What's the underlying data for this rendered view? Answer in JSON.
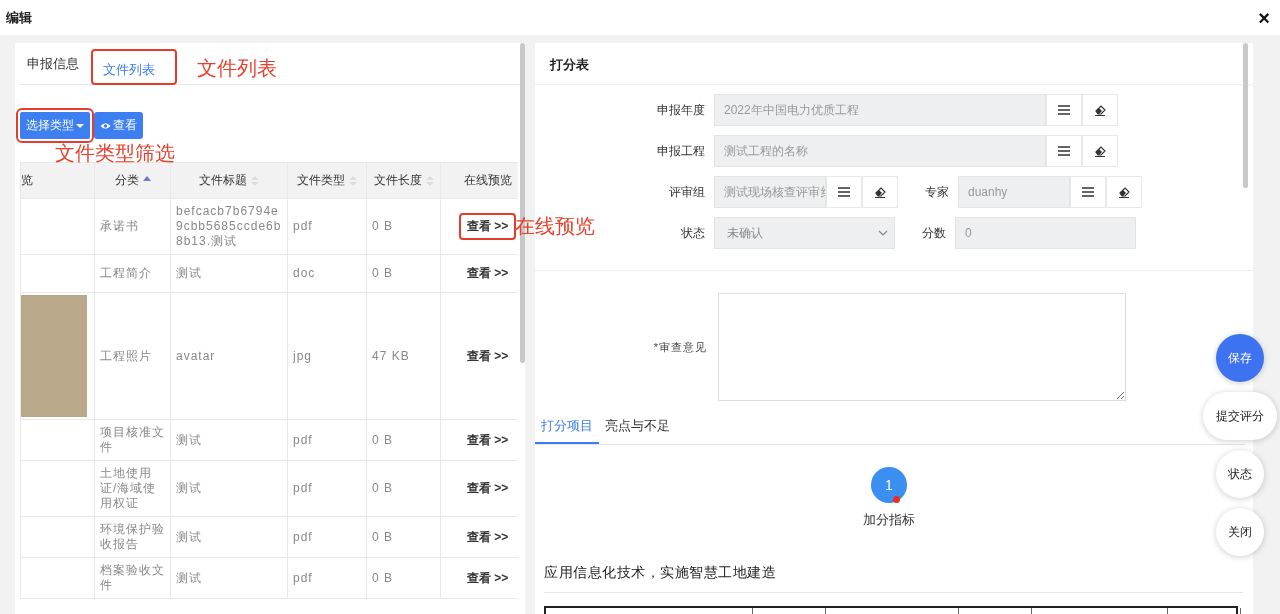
{
  "window": {
    "title": "编辑",
    "close": "×"
  },
  "left_tabs": [
    {
      "label": "申报信息",
      "selected": false,
      "highlighted": false
    },
    {
      "label": "文件列表",
      "selected": true,
      "highlighted": true,
      "annotation": "文件列表"
    }
  ],
  "toolbar": {
    "filter": {
      "label": "选择类型",
      "highlighted": true,
      "annotation": "文件类型筛选"
    },
    "view": {
      "label": "查看"
    }
  },
  "file_table": {
    "columns": [
      {
        "label": "览",
        "sortable": false
      },
      {
        "label": "分类",
        "sortable": true,
        "sorted_ascending": true
      },
      {
        "label": "文件标题",
        "sortable": true,
        "sorted_ascending": false
      },
      {
        "label": "文件类型",
        "sortable": true,
        "sorted_ascending": false
      },
      {
        "label": "文件长度",
        "sortable": true,
        "sorted_ascending": false
      },
      {
        "label": "在线预览",
        "sortable": false
      }
    ],
    "rows": [
      {
        "photo": false,
        "category": "承诺书",
        "title": "befcacb7b6794e9cbb5685ccde6b8b13.测试",
        "type": "pdf",
        "size": "0 B",
        "link": "查看 >>",
        "highlighted": true,
        "annotation": "在线预览"
      },
      {
        "photo": false,
        "category": "工程简介",
        "title": "测试",
        "type": "doc",
        "size": "0 B",
        "link": "查看 >>",
        "highlighted": false
      },
      {
        "photo": true,
        "category": "工程照片",
        "title": "avatar",
        "type": "jpg",
        "size": "47 KB",
        "link": "查看 >>",
        "highlighted": false
      },
      {
        "photo": false,
        "category": "项目核准文件",
        "title": "测试",
        "type": "pdf",
        "size": "0 B",
        "link": "查看 >>",
        "highlighted": false
      },
      {
        "photo": false,
        "category": "土地使用证/海域使用权证",
        "title": "测试",
        "type": "pdf",
        "size": "0 B",
        "link": "查看 >>",
        "highlighted": false
      },
      {
        "photo": false,
        "category": "环境保护验收报告",
        "title": "测试",
        "type": "pdf",
        "size": "0 B",
        "link": "查看 >>",
        "highlighted": false
      },
      {
        "photo": false,
        "category": "档案验收文件",
        "title": "测试",
        "type": "pdf",
        "size": "0 B",
        "link": "查看 >>",
        "highlighted": false
      }
    ]
  },
  "score_sheet": {
    "title": "打分表",
    "form_rows": [
      [
        {
          "label": "申报年度",
          "kind": "picker",
          "value": "2022年中国电力优质工程"
        }
      ],
      [
        {
          "label": "申报工程",
          "kind": "picker",
          "value": "测试工程的名称"
        }
      ],
      [
        {
          "label": "评审组",
          "kind": "picker",
          "value": "测试现场核查评审纟"
        },
        {
          "label": "专家",
          "kind": "picker",
          "value": "duanhy"
        }
      ],
      [
        {
          "label": "状态",
          "kind": "select",
          "value": "未确认"
        },
        {
          "label": "分数",
          "kind": "text",
          "value": "0"
        }
      ]
    ],
    "opinion": {
      "label": "*审查意见"
    },
    "tabs": [
      {
        "label": "打分项目",
        "selected": true
      },
      {
        "label": "亮点与不足",
        "selected": false
      }
    ],
    "steps": [
      {
        "number": "1",
        "label": "加分指标",
        "flagged": true
      }
    ],
    "section_title": "应用信息化技术，实施智慧工地建造"
  },
  "actions": [
    {
      "label": "保存",
      "kind": "primary"
    },
    {
      "label": "提交评分",
      "kind": "default"
    },
    {
      "label": "状态",
      "kind": "default"
    },
    {
      "label": "关闭",
      "kind": "default"
    }
  ]
}
